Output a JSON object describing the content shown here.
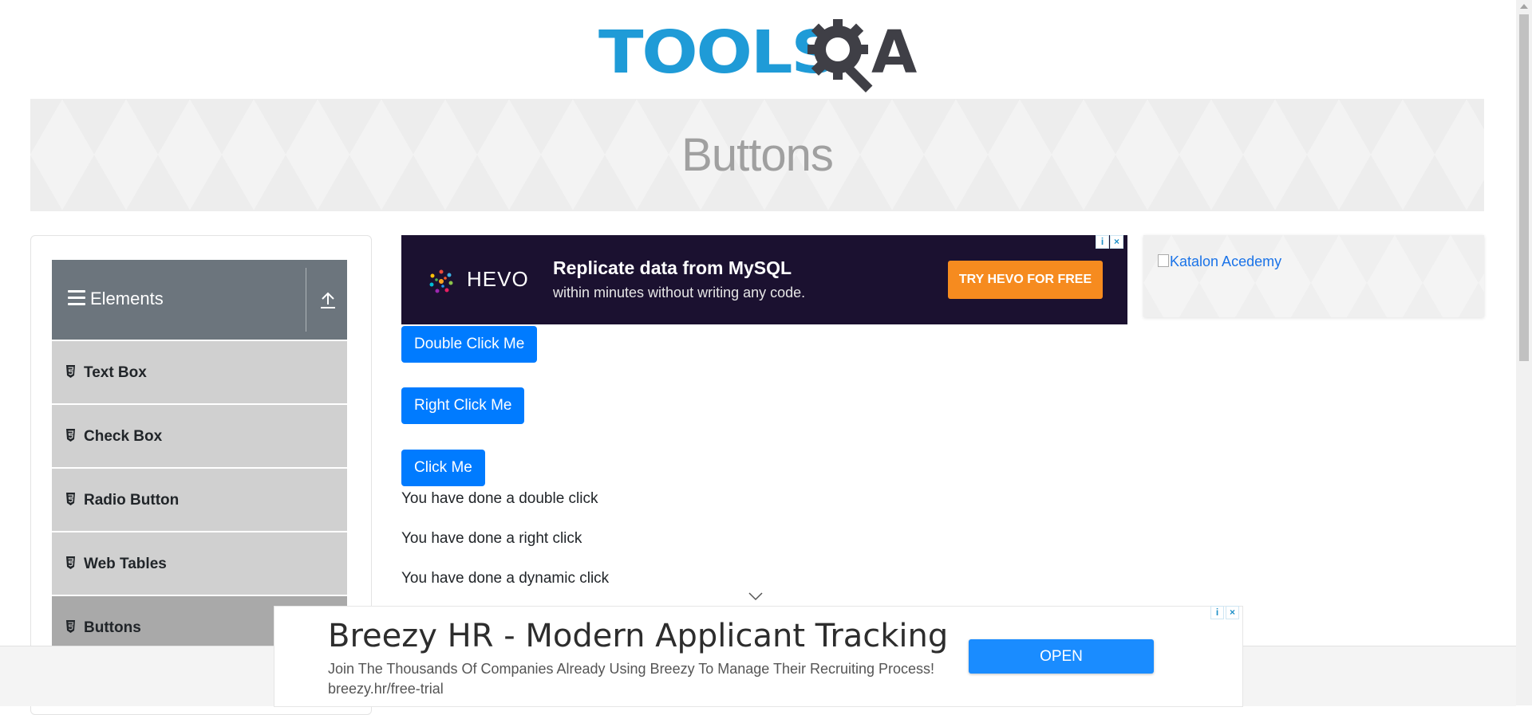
{
  "header": {
    "logo_tools": "TOOLS",
    "logo_qa_letter": "A"
  },
  "banner": {
    "title": "Buttons"
  },
  "sidebar": {
    "group_title": "Elements",
    "items": [
      {
        "label": "Text Box"
      },
      {
        "label": "Check Box"
      },
      {
        "label": "Radio Button"
      },
      {
        "label": "Web Tables"
      },
      {
        "label": "Buttons",
        "active": true
      }
    ]
  },
  "ad_top": {
    "brand": "HEVO",
    "headline": "Replicate data from MySQL",
    "subline": "within minutes without writing any code.",
    "cta": "TRY HEVO FOR FREE",
    "bg_color": "#1b1130",
    "cta_color": "#f68b1f"
  },
  "ad_right": {
    "alt_text": "Katalon Acedemy"
  },
  "buttons": {
    "double_click": "Double Click Me",
    "right_click": "Right Click Me",
    "click": "Click Me",
    "color": "#007bff"
  },
  "messages": {
    "double": "You have done a double click",
    "right": "You have done a right click",
    "dynamic": "You have done a dynamic click"
  },
  "ad_bottom": {
    "headline": "Breezy HR - Modern Applicant Tracking",
    "body": "Join The Thousands Of Companies Already Using Breezy To Manage Their Recruiting Process! breezy.hr/free-trial",
    "cta": "OPEN"
  },
  "ad_choices": {
    "info": "i",
    "close": "×"
  }
}
